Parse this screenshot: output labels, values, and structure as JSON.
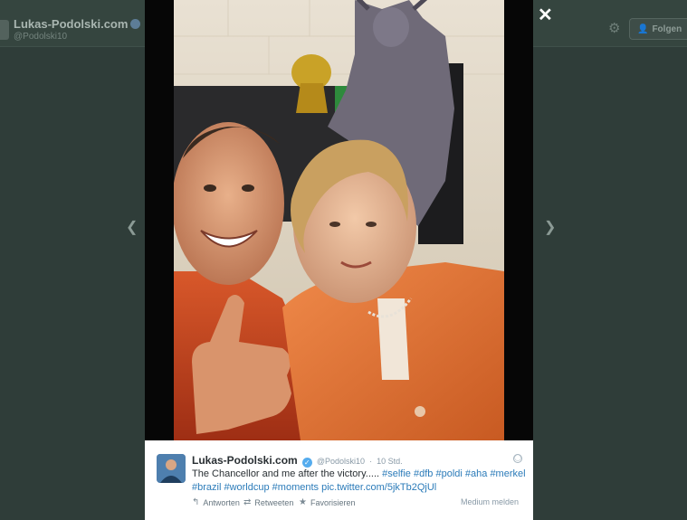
{
  "profile": {
    "name": "Lukas-Podolski.com",
    "handle": "@Podolski10",
    "follow_label": "Folgen"
  },
  "icons": {
    "close": "close-icon",
    "gear": "gear-icon",
    "verified": "verified-badge-icon",
    "prev": "chevron-left-icon",
    "next": "chevron-right-icon",
    "reply": "reply-icon",
    "retweet": "retweet-icon",
    "favorite": "star-icon",
    "globe": "globe-icon"
  },
  "media": {
    "description_visible": false
  },
  "tweet": {
    "name": "Lukas-Podolski.com",
    "handle": "@Podolski10",
    "time": "10 Std.",
    "text_plain": "The Chancellor and me after the victory.....",
    "hashtags_line1": [
      "#selfie",
      "#dfb",
      "#poldi",
      "#aha",
      "#merkel"
    ],
    "hashtags_line2": [
      "#brazil",
      "#worldcup",
      "#moments"
    ],
    "link": "pic.twitter.com/5jkTb2QjUl",
    "actions": {
      "reply": "Antworten",
      "retweet": "Retweeten",
      "favorite": "Favorisieren",
      "report": "Medium melden"
    }
  },
  "colors": {
    "link": "#2b7bb9",
    "verified": "#55acee",
    "backdrop": "#2f3d39"
  }
}
